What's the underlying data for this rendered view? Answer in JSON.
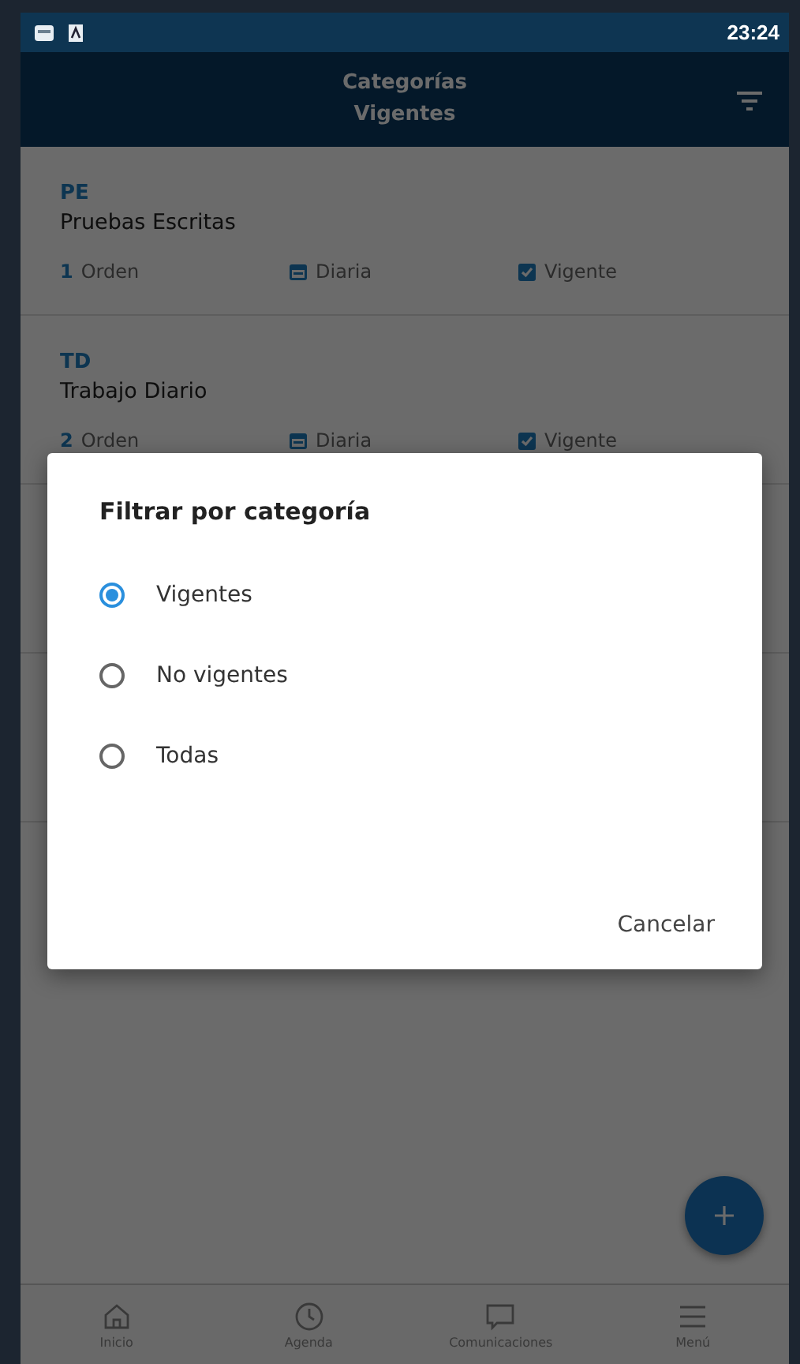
{
  "status_bar": {
    "time": "23:24"
  },
  "header": {
    "title_lines": [
      "Categorías",
      "Vigentes"
    ]
  },
  "categories": [
    {
      "code": "PE",
      "name": "Pruebas Escritas",
      "order_number": "1",
      "order_label": "Orden",
      "frequency": "Diaria",
      "status": "Vigente"
    },
    {
      "code": "TD",
      "name": "Trabajo Diario",
      "order_number": "2",
      "order_label": "Orden",
      "frequency": "Diaria",
      "status": "Vigente"
    }
  ],
  "dialog": {
    "title": "Filtrar por categoría",
    "options": [
      {
        "label": "Vigentes",
        "selected": true
      },
      {
        "label": "No vigentes",
        "selected": false
      },
      {
        "label": "Todas",
        "selected": false
      }
    ],
    "cancel": "Cancelar"
  },
  "bottom_nav": [
    {
      "kind": "home",
      "label": "Inicio"
    },
    {
      "kind": "clock",
      "label": "Agenda"
    },
    {
      "kind": "chat",
      "label": "Comunicaciones"
    },
    {
      "kind": "menu",
      "label": "Menú"
    }
  ]
}
